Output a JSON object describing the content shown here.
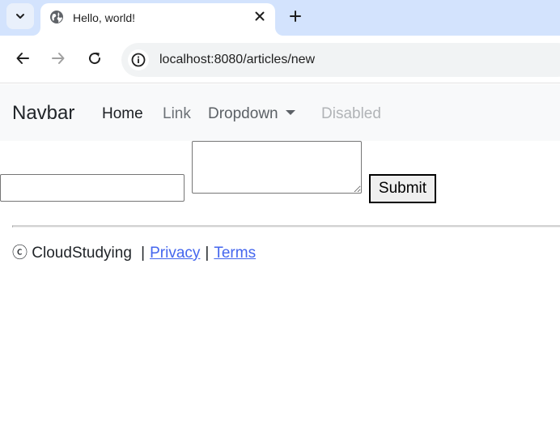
{
  "browser": {
    "tab": {
      "title": "Hello, world!",
      "favicon": "globe-icon"
    },
    "address_bar": {
      "url": "localhost:8080/articles/new"
    },
    "icons": {
      "tab_search": "chevron-down-icon",
      "close_tab": "close-icon",
      "new_tab": "plus-icon",
      "back": "arrow-left-icon",
      "forward": "arrow-right-icon",
      "reload": "reload-icon",
      "site_info": "info-icon"
    },
    "colors": {
      "tabstrip": "#d3e3fd",
      "omnibox": "#f1f3f4"
    }
  },
  "navbar": {
    "brand": "Navbar",
    "items": [
      {
        "label": "Home",
        "state": "active"
      },
      {
        "label": "Link",
        "state": "normal"
      },
      {
        "label": "Dropdown",
        "state": "dropdown"
      },
      {
        "label": "Disabled",
        "state": "disabled"
      }
    ],
    "background": "#f8f9fa"
  },
  "form": {
    "title_value": "",
    "body_value": "",
    "submit_label": "Submit"
  },
  "footer": {
    "copyright_symbol": "ⓒ",
    "company": "CloudStudying",
    "separator": "|",
    "privacy_label": "Privacy",
    "terms_label": "Terms",
    "link_color": "#4466ee"
  }
}
